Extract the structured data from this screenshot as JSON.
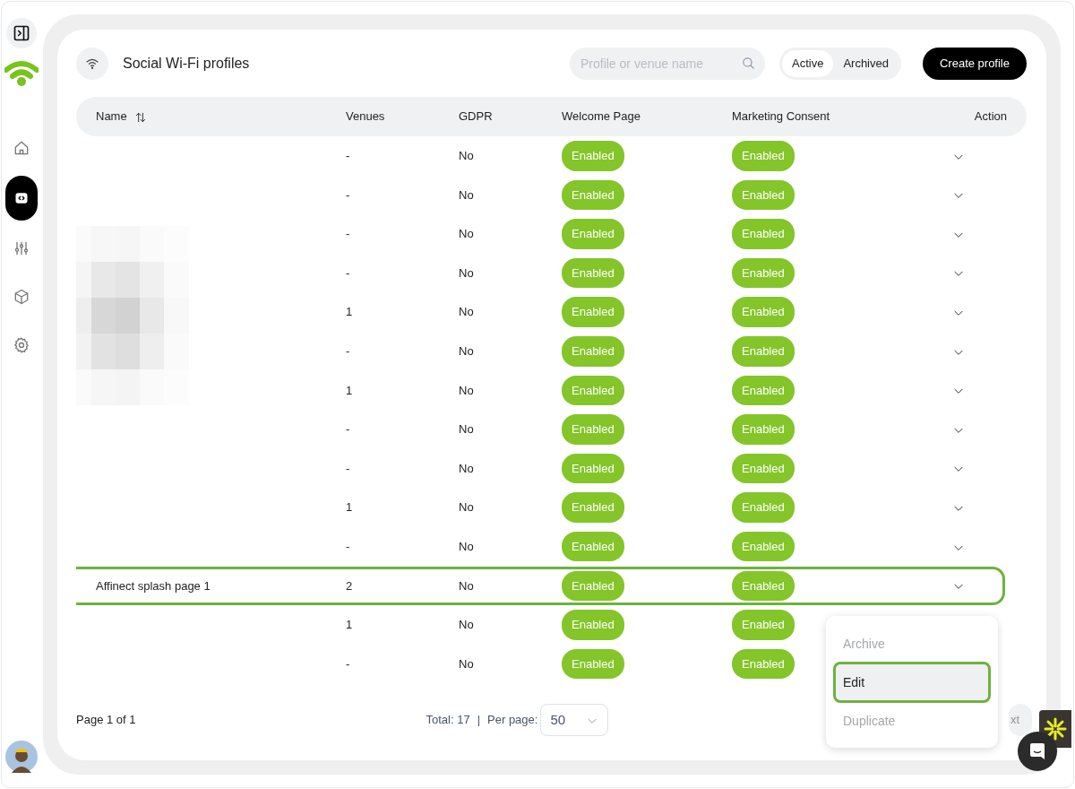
{
  "sidebar": {
    "items": [
      {
        "kind": "home",
        "selected": false
      },
      {
        "kind": "code",
        "selected": true
      },
      {
        "kind": "sliders",
        "selected": false
      },
      {
        "kind": "cube",
        "selected": false
      },
      {
        "kind": "gear",
        "selected": false
      }
    ]
  },
  "header": {
    "title": "Social Wi-Fi profiles",
    "search": {
      "placeholder": "Profile or venue name"
    },
    "tabs": [
      {
        "label": "Active",
        "selected": true
      },
      {
        "label": "Archived",
        "selected": false
      }
    ],
    "create_button": "Create profile"
  },
  "table": {
    "columns": [
      "Name",
      "Venues",
      "GDPR",
      "Welcome Page",
      "Marketing Consent",
      "Action"
    ],
    "rows": [
      {
        "venues": "-",
        "gdpr": "No",
        "welcome": "Enabled",
        "marketing": "Enabled",
        "selected": false
      },
      {
        "venues": "-",
        "gdpr": "No",
        "welcome": "Enabled",
        "marketing": "Enabled",
        "selected": false
      },
      {
        "venues": "-",
        "gdpr": "No",
        "welcome": "Enabled",
        "marketing": "Enabled",
        "selected": false
      },
      {
        "venues": "-",
        "gdpr": "No",
        "welcome": "Enabled",
        "marketing": "Enabled",
        "selected": false
      },
      {
        "venues": "1",
        "gdpr": "No",
        "welcome": "Enabled",
        "marketing": "Enabled",
        "selected": false
      },
      {
        "venues": "-",
        "gdpr": "No",
        "welcome": "Enabled",
        "marketing": "Enabled",
        "selected": false
      },
      {
        "venues": "1",
        "gdpr": "No",
        "welcome": "Enabled",
        "marketing": "Enabled",
        "selected": false
      },
      {
        "venues": "-",
        "gdpr": "No",
        "welcome": "Enabled",
        "marketing": "Enabled",
        "selected": false
      },
      {
        "venues": "-",
        "gdpr": "No",
        "welcome": "Enabled",
        "marketing": "Enabled",
        "selected": false
      },
      {
        "venues": "1",
        "gdpr": "No",
        "welcome": "Enabled",
        "marketing": "Enabled",
        "selected": false
      },
      {
        "venues": "-",
        "gdpr": "No",
        "welcome": "Enabled",
        "marketing": "Enabled",
        "selected": false
      },
      {
        "name": "Affinect splash page 1",
        "venues": "2",
        "gdpr": "No",
        "welcome": "Enabled",
        "marketing": "Enabled",
        "selected": true,
        "action_menu": [
          {
            "label": "Archive",
            "selected": false,
            "disabled": true
          },
          {
            "label": "Edit",
            "selected": true,
            "disabled": false
          },
          {
            "label": "Duplicate",
            "selected": false,
            "disabled": true
          }
        ]
      },
      {
        "venues": "1",
        "gdpr": "No",
        "welcome": "Enabled",
        "marketing": "Enabled",
        "selected": false
      },
      {
        "venues": "-",
        "gdpr": "No",
        "welcome": "Enabled",
        "marketing": "Enabled",
        "selected": false
      }
    ]
  },
  "footer": {
    "page": "Page 1 of 1",
    "total": "Total: 17",
    "separator": "|",
    "per_page_label": "Per page:",
    "per_page": "50",
    "next_button": "xt"
  }
}
